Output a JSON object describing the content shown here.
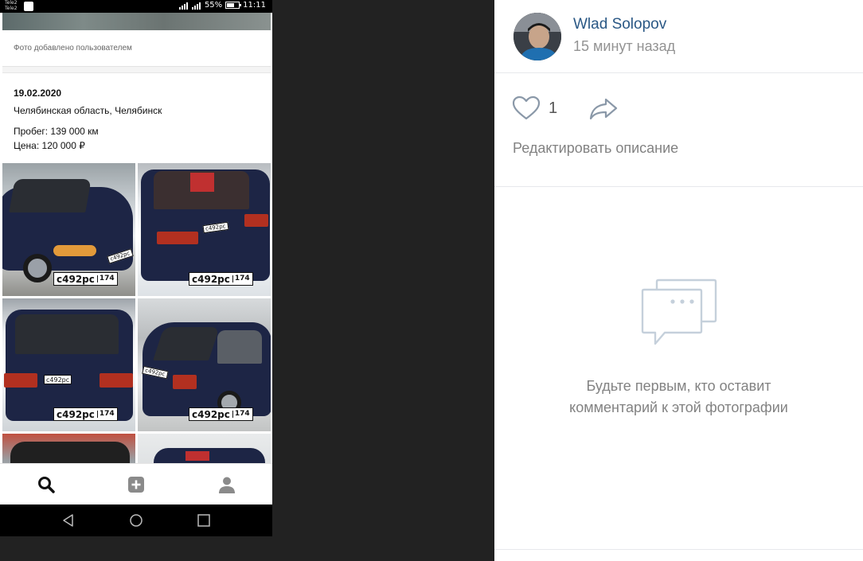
{
  "phone": {
    "status": {
      "carrier1": "Tele2",
      "carrier2": "Tele2",
      "battery": "55%",
      "time": "11:11"
    },
    "added_by_user": "Фото добавлено пользователем",
    "post": {
      "date": "19.02.2020",
      "region": "Челябинская область, Челябинск",
      "mileage": "Пробег: 139 000 км",
      "price": "Цена: 120 000 ₽"
    },
    "plates": {
      "number": "с492рс",
      "region": "174"
    },
    "nav": {
      "search_icon": "search-icon",
      "add_icon": "plus-square-icon",
      "profile_icon": "person-icon"
    }
  },
  "panel": {
    "author_name": "Wlad Solopov",
    "post_time": "15 минут назад",
    "likes_count": "1",
    "edit_description": "Редактировать описание",
    "empty_comments_line1": "Будьте первым, кто оставит",
    "empty_comments_line2": "комментарий к этой фотографии",
    "colors": {
      "link": "#2a5885",
      "muted": "#828282",
      "icon": "#c5d0db"
    }
  }
}
